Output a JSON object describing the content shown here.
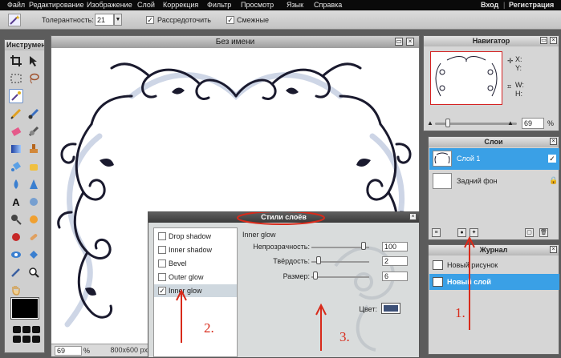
{
  "menu": {
    "items": [
      "Файл",
      "Редактирование",
      "Изображение",
      "Слой",
      "Коррекция",
      "Фильтр",
      "Просмотр",
      "Язык",
      "Справка"
    ],
    "login": "Вход",
    "separator": "|",
    "register": "Регистрация"
  },
  "options_bar": {
    "tolerance_label": "Толерантность:",
    "tolerance_value": "21",
    "antialias_label": "Рассредоточить",
    "antialias_checked": true,
    "contiguous_label": "Смежные",
    "contiguous_checked": true
  },
  "toolbox": {
    "title": "Инструмент"
  },
  "document": {
    "title": "Без имени",
    "zoom": "69",
    "zoom_unit": "%",
    "size": "800x600 px"
  },
  "navigator": {
    "title": "Навигатор",
    "x_label": "X:",
    "y_label": "Y:",
    "w_label": "W:",
    "h_label": "H:",
    "zoom": "69",
    "zoom_level": 0.69
  },
  "layers": {
    "title": "Слои",
    "items": [
      {
        "name": "Слой 1",
        "selected": true,
        "checked": true
      },
      {
        "name": "Задний фон",
        "selected": false,
        "locked": true
      }
    ]
  },
  "history": {
    "title": "Журнал",
    "items": [
      {
        "label": "Новый рисунок",
        "selected": false
      },
      {
        "label": "Новый слой",
        "selected": true
      }
    ]
  },
  "layer_styles": {
    "title": "Стили слоёв",
    "effects": [
      {
        "label": "Drop shadow",
        "checked": false,
        "selected": false
      },
      {
        "label": "Inner shadow",
        "checked": false,
        "selected": false
      },
      {
        "label": "Bevel",
        "checked": false,
        "selected": false
      },
      {
        "label": "Outer glow",
        "checked": false,
        "selected": false
      },
      {
        "label": "Inner glow",
        "checked": true,
        "selected": true
      }
    ],
    "section_title": "Inner glow",
    "opacity_label": "Непрозрачность:",
    "opacity_value": "100",
    "hardness_label": "Твёрдость:",
    "hardness_value": "2",
    "size_label": "Размер:",
    "size_value": "6",
    "color_label": "Цвет:",
    "color_value": "#3c5077"
  },
  "annotations": {
    "one": "1.",
    "two": "2.",
    "three": "3.",
    "color": "#d82a1a"
  },
  "colors": {
    "foreground": "#000000",
    "selection_blue": "#3aa0e6",
    "ornament": "#1a1a2e"
  },
  "icons": [
    "magic-wand-icon",
    "crop-icon",
    "move-icon",
    "marquee-icon",
    "lasso-icon",
    "pencil-icon",
    "brush-icon",
    "eraser-icon",
    "smudge-icon",
    "gradient-icon",
    "stamp-icon",
    "bucket-icon",
    "sponge-icon",
    "drop-icon",
    "sharpen-icon",
    "text-icon",
    "blur-icon",
    "zoom-icon",
    "hand-icon",
    "eye-icon",
    "heal-icon"
  ]
}
